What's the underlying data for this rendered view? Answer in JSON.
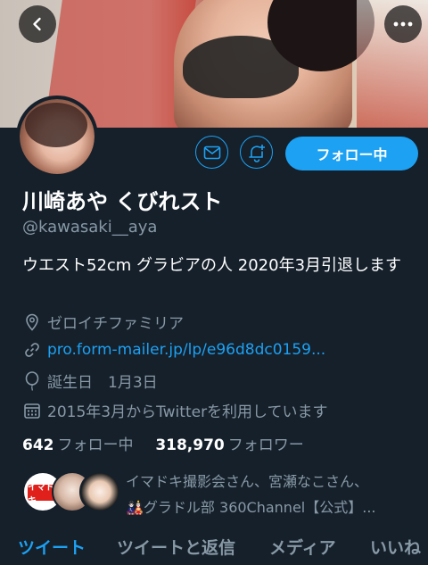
{
  "profile": {
    "display_name": "川崎あや くびれスト",
    "handle": "@kawasaki__aya",
    "bio": "ウエスト52cm グラビアの人 2020年3月引退します",
    "location": "ゼロイチファミリア",
    "website": "pro.form-mailer.jp/lp/e96d8dc0159...",
    "birthday": "誕生日　1月3日",
    "joined": "2015年3月からTwitterを利用しています"
  },
  "stats": {
    "following_count": "642",
    "following_label": "フォロー中",
    "followers_count": "318,970",
    "followers_label": "フォロワー"
  },
  "actions": {
    "follow_label": "フォロー中"
  },
  "followed_by": {
    "line1": "イマドキ撮影会さん、宮瀬なこさん、",
    "line2": "🎎グラドル部 360Channel【公式】...",
    "avatar1_label": "イマドキ"
  },
  "tabs": [
    {
      "label": "ツイート",
      "active": true
    },
    {
      "label": "ツイートと返信",
      "active": false
    },
    {
      "label": "メディア",
      "active": false
    },
    {
      "label": "いいね",
      "active": false
    }
  ],
  "colors": {
    "background": "#15202b",
    "accent": "#1da1f2",
    "secondary_text": "#8899a6"
  },
  "icons": {
    "back": "back-arrow-icon",
    "more": "more-dots-icon",
    "message": "mail-icon",
    "notify": "bell-plus-icon",
    "location": "location-pin-icon",
    "link": "link-icon",
    "birthday": "balloon-icon",
    "joined": "calendar-icon"
  }
}
